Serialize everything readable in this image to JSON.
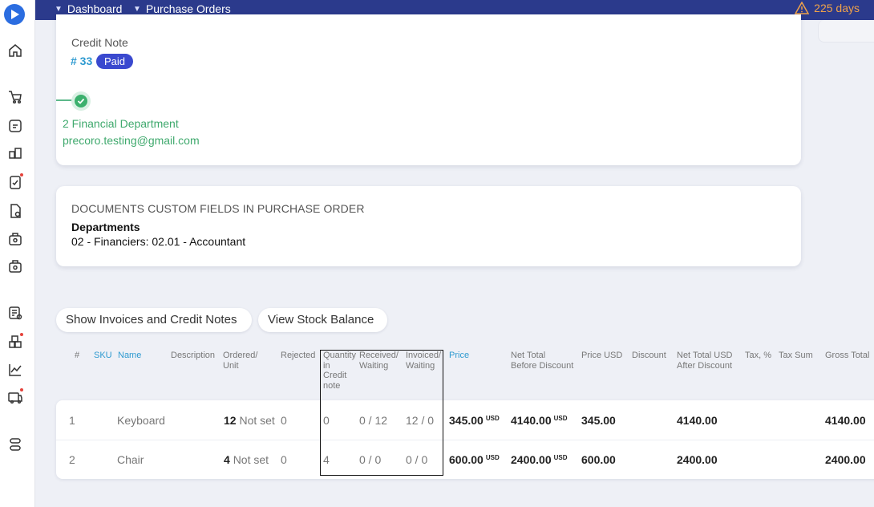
{
  "topbar": {
    "crumbs": [
      "Dashboard",
      "Purchase Orders"
    ],
    "trial_days": "225 days"
  },
  "credit_note": {
    "label": "Credit Note",
    "number": "# 33",
    "status": "Paid",
    "approver_department": "2 Financial Department",
    "approver_email": "precoro.testing@gmail.com"
  },
  "custom_fields": {
    "title": "DOCUMENTS CUSTOM FIELDS IN PURCHASE ORDER",
    "field_name": "Departments",
    "field_value": "02 - Financiers: 02.01 - Accountant"
  },
  "buttons": {
    "show_invoices": "Show Invoices and Credit Notes",
    "view_stock": "View Stock Balance"
  },
  "table": {
    "headers": {
      "num": "#",
      "sku": "SKU",
      "name": "Name",
      "description": "Description",
      "ordered": "Ordered/\nUnit",
      "rejected": "Rejected",
      "qty_credit": "Quantity\nin\nCredit\nnote",
      "received": "Received/\nWaiting",
      "invoiced": "Invoiced/\nWaiting",
      "price": "Price",
      "net_before": "Net Total\nBefore Discount",
      "price_usd": "Price USD",
      "discount": "Discount",
      "net_after": "Net Total USD\nAfter Discount",
      "tax": "Tax, %",
      "tax_sum": "Tax Sum",
      "gross": "Gross Total"
    },
    "rows": [
      {
        "num": "1",
        "name": "Keyboard",
        "ordered_qty": "12",
        "ordered_unit": "Not set",
        "rejected": "0",
        "qty_credit": "0",
        "received": "0 / 12",
        "invoiced": "12 / 0",
        "price": "345.00",
        "price_cur": "USD",
        "net_before": "4140.00",
        "net_before_cur": "USD",
        "price_usd": "345.00",
        "net_after": "4140.00",
        "gross": "4140.00"
      },
      {
        "num": "2",
        "name": "Chair",
        "ordered_qty": "4",
        "ordered_unit": "Not set",
        "rejected": "0",
        "qty_credit": "4",
        "received": "0 / 0",
        "invoiced": "0 / 0",
        "price": "600.00",
        "price_cur": "USD",
        "net_before": "2400.00",
        "net_before_cur": "USD",
        "price_usd": "600.00",
        "net_after": "2400.00",
        "gross": "2400.00"
      }
    ]
  },
  "colors": {
    "topbar": "#2b3a8c",
    "badge": "#3a49cf",
    "approved_green": "#3fa96d",
    "link_blue": "#2e9ad0",
    "warning_orange": "#f0a24a"
  },
  "icons": {
    "sidebar": [
      "home-icon",
      "purchase-cart-icon",
      "requests-icon",
      "catalog-icon",
      "approvals-icon",
      "invoices-icon",
      "receipts-icon",
      "payments-icon",
      "budgets-icon",
      "suppliers-icon",
      "analytics-icon",
      "warehouse-icon",
      "settings-icon"
    ]
  }
}
